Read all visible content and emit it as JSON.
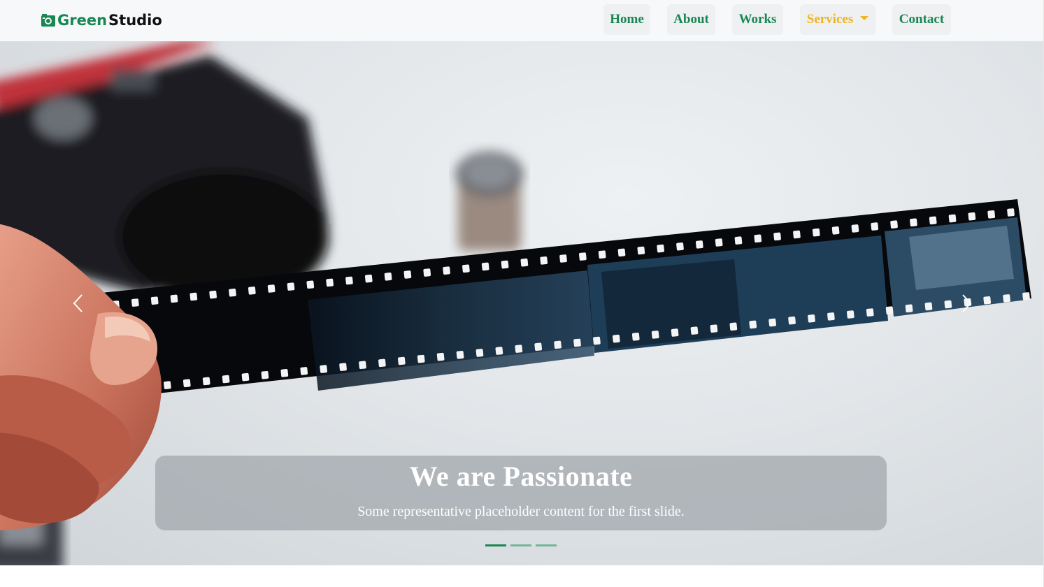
{
  "brand": {
    "part1": "Green",
    "part2": "Studio",
    "icon": "camera-icon",
    "color": "#198754"
  },
  "nav": {
    "items": [
      {
        "label": "Home"
      },
      {
        "label": "About"
      },
      {
        "label": "Works"
      },
      {
        "label": "Services",
        "dropdown": true,
        "active": true
      },
      {
        "label": "Contact"
      }
    ],
    "colors": {
      "link": "#198754",
      "active": "#f0b41c"
    }
  },
  "carousel": {
    "caption": {
      "title": "We are Passionate",
      "text": "Some representative placeholder content for the first slide."
    },
    "controls": {
      "prev_icon": "chevron-left-icon",
      "next_icon": "chevron-right-icon"
    },
    "slides": 3,
    "active_slide": 1
  }
}
